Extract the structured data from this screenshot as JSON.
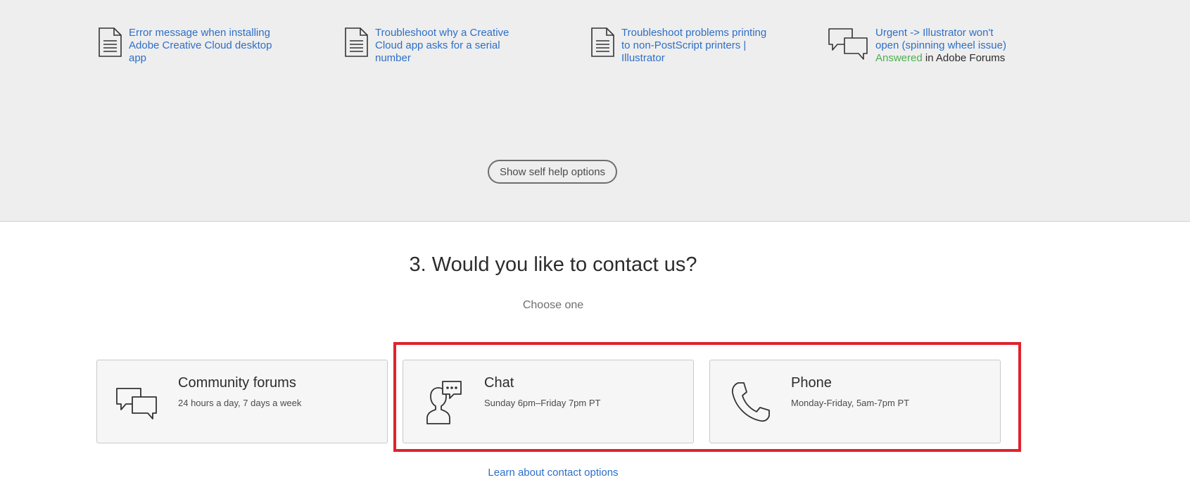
{
  "articles": [
    {
      "icon": "document-icon",
      "title": "Error message when installing Adobe Creative Cloud desktop app"
    },
    {
      "icon": "document-icon",
      "title": "Troubleshoot why a Creative Cloud app asks for a serial number"
    },
    {
      "icon": "document-icon",
      "title": "Troubleshoot problems printing to non-PostScript printers | Illustrator"
    },
    {
      "icon": "forum-icon",
      "title": "Urgent -> Illustrator won't open (spinning wheel issue)",
      "status": "Answered",
      "source": "in Adobe Forums"
    }
  ],
  "self_help_button": "Show self help options",
  "contact": {
    "heading": "3. Would you like to contact us?",
    "subheading": "Choose one",
    "options": [
      {
        "icon": "forum-icon",
        "title": "Community forums",
        "hours": "24 hours a day, 7 days a week"
      },
      {
        "icon": "chat-icon",
        "title": "Chat",
        "hours": "Sunday 6pm–Friday 7pm PT"
      },
      {
        "icon": "phone-icon",
        "title": "Phone",
        "hours": "Monday-Friday, 5am-7pm PT"
      }
    ],
    "learn_link": "Learn about contact options"
  },
  "colors": {
    "link": "#2d6fc7",
    "answered": "#4caf50",
    "highlight": "#e0222d",
    "band": "#eeeeee"
  }
}
